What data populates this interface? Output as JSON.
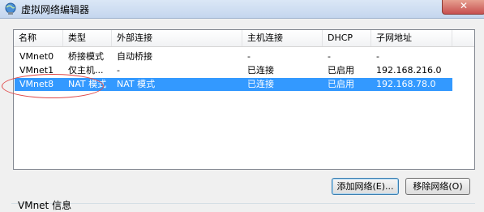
{
  "window": {
    "title": "虚拟网络编辑器",
    "close_label": "✕"
  },
  "table": {
    "columns": [
      "名称",
      "类型",
      "外部连接",
      "主机连接",
      "DHCP",
      "子网地址"
    ],
    "rows": [
      {
        "name": "VMnet0",
        "type": "桥接模式",
        "external": "自动桥接",
        "host": "-",
        "dhcp": "-",
        "subnet": "-"
      },
      {
        "name": "VMnet1",
        "type": "仅主机...",
        "external": "-",
        "host": "已连接",
        "dhcp": "已启用",
        "subnet": "192.168.216.0"
      },
      {
        "name": "VMnet8",
        "type": "NAT 模式",
        "external": "NAT 模式",
        "host": "已连接",
        "dhcp": "已启用",
        "subnet": "192.168.78.0",
        "selected": true
      }
    ]
  },
  "buttons": {
    "add_network": "添加网络(E)...",
    "remove_network": "移除网络(O)"
  },
  "info_group": {
    "label": "VMnet 信息"
  },
  "colors": {
    "selection": "#3399ff",
    "annotation": "#e04848"
  },
  "icons": {
    "title_icon": "network-globe-icon",
    "close": "close-icon"
  }
}
